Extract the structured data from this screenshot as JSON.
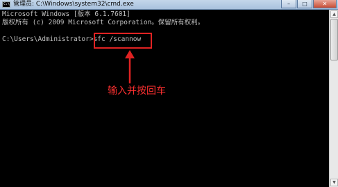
{
  "window": {
    "title": "管理员: C:\\Windows\\system32\\cmd.exe",
    "icon": "cmd-icon",
    "icon_text": "C:\\",
    "minimize_glyph": "–",
    "maximize_glyph": "□",
    "close_glyph": "✕"
  },
  "console": {
    "lines": [
      "Microsoft Windows [版本 6.1.7601]",
      "版权所有 (c) 2009 Microsoft Corporation。保留所有权利。"
    ],
    "prompt": "C:\\Users\\Administrator>",
    "command": "sfc /scannow"
  },
  "annotation": {
    "text": "输入并按回车",
    "color": "#ff3030"
  },
  "scrollbar": {
    "up_glyph": "▲",
    "down_glyph": "▼"
  }
}
